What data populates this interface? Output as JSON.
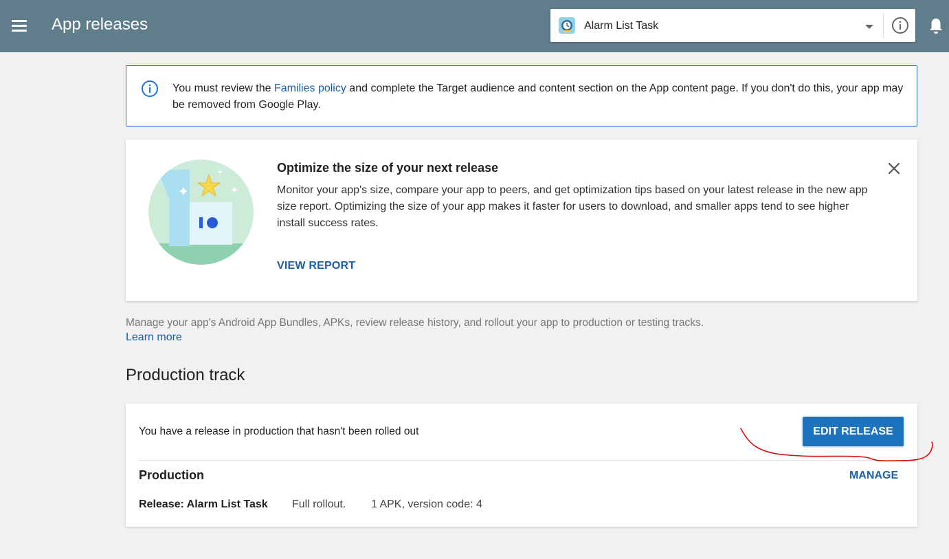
{
  "header": {
    "title": "App releases",
    "app_selector": {
      "selected": "Alarm List Task"
    }
  },
  "notice": {
    "text_before": "You must review the ",
    "link": "Families policy",
    "text_after": " and complete the Target audience and content section on the App content page. If you don't do this, your app may be removed from Google Play."
  },
  "optimize_card": {
    "title": "Optimize the size of your next release",
    "body": "Monitor your app's size, compare your app to peers, and get optimization tips based on your latest release in the new app size report. Optimizing the size of your app makes it faster for users to download, and smaller apps tend to see higher install success rates.",
    "action": "VIEW REPORT"
  },
  "description": {
    "text": "Manage your app's Android App Bundles, APKs, review release history, and rollout your app to production or testing tracks.",
    "learn_more": "Learn more"
  },
  "production_track": {
    "title": "Production track",
    "message": "You have a release in production that hasn't been rolled out",
    "edit_button": "EDIT RELEASE",
    "track_label": "Production",
    "manage": "MANAGE",
    "release": {
      "name": "Release: Alarm List Task",
      "rollout": "Full rollout.",
      "apk_info": "1 APK, version code: 4"
    }
  },
  "colors": {
    "topbar": "#607d8b",
    "accent_blue": "#1e73be",
    "link_blue": "#1a5fa8",
    "annotation_red": "#e00000"
  }
}
